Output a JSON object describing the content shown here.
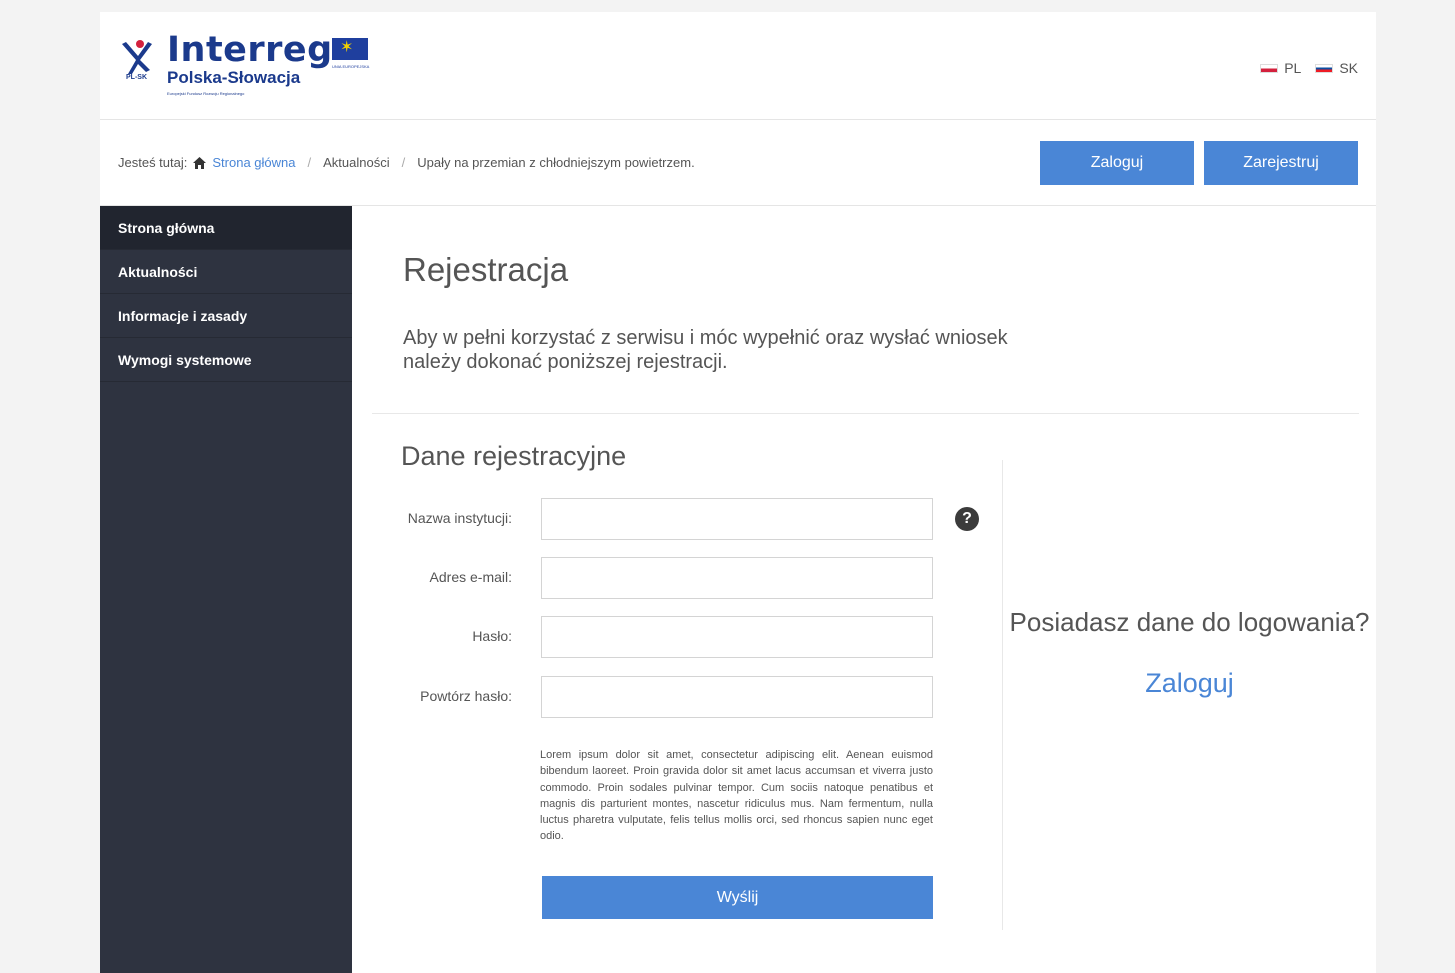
{
  "header": {
    "logo": {
      "brand": "Interreg",
      "subtitle": "Polska-Słowacja",
      "mark_label": "PL-SK",
      "eu_text": "UNIA EUROPEJSKA",
      "fund_text": "Europejski Fundusz Rozwoju Regionalnego"
    },
    "languages": [
      {
        "code": "PL",
        "flag": "flag-pl-icon"
      },
      {
        "code": "SK",
        "flag": "flag-sk-icon"
      }
    ]
  },
  "breadcrumb": {
    "prefix": "Jesteś tutaj:",
    "items": [
      "Strona główna",
      "Aktualności",
      "Upały na przemian z chłodniejszym powietrzem."
    ],
    "separator": "/"
  },
  "top_buttons": {
    "login": "Zaloguj",
    "register": "Zarejestruj"
  },
  "sidebar": {
    "items": [
      {
        "label": "Strona główna"
      },
      {
        "label": "Aktualności"
      },
      {
        "label": "Informacje i zasady"
      },
      {
        "label": "Wymogi systemowe"
      }
    ]
  },
  "main": {
    "title": "Rejestracja",
    "intro": "Aby w pełni korzystać z serwisu i móc wypełnić oraz wysłać wniosek należy dokonać poniższej rejestracji.",
    "form_title": "Dane rejestracyjne",
    "fields": [
      {
        "label": "Nazwa instytucji:",
        "value": ""
      },
      {
        "label": "Adres e-mail:",
        "value": ""
      },
      {
        "label": "Hasło:",
        "value": ""
      },
      {
        "label": "Powtórz hasło:",
        "value": ""
      }
    ],
    "help_glyph": "?",
    "lorem": "Lorem ipsum dolor sit amet, consectetur adipiscing elit. Aenean euismod bibendum laoreet. Proin gravida dolor sit amet lacus accumsan et viverra justo commodo. Proin sodales pulvinar tempor. Cum sociis natoque penatibus et magnis dis parturient montes, nascetur ridiculus mus. Nam fermentum, nulla luctus pharetra vulputate, felis tellus mollis orci, sed rhoncus sapien nunc eget odio.",
    "submit": "Wyślij"
  },
  "side_panel": {
    "question": "Posiadasz dane do logowania?",
    "login_link": "Zaloguj"
  },
  "colors": {
    "accent": "#4a86d6",
    "sidebar_bg": "#2e3340",
    "sidebar_active": "#21252f",
    "brand": "#1b3a8c"
  }
}
